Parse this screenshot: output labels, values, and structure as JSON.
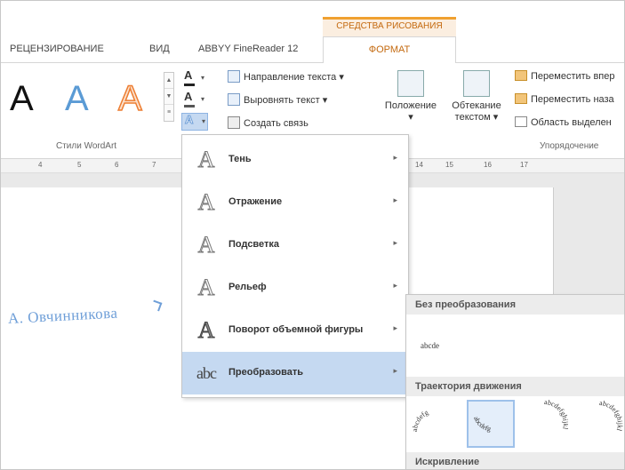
{
  "ribbon": {
    "context_group": "СРЕДСТВА РИСОВАНИЯ",
    "tabs": [
      "РЕЦЕНЗИРОВАНИЕ",
      "ВИД",
      "ABBYY FineReader 12",
      "ФОРМАТ"
    ],
    "wordart_styles_label": "Стили WordArt",
    "wordart_samples": [
      "A",
      "A",
      "A"
    ],
    "text_commands": [
      "Направление текста",
      "Выровнять текст",
      "Создать связь"
    ],
    "big_buttons": [
      {
        "label": "Положение"
      },
      {
        "label": "Обтекание текстом"
      }
    ],
    "arrange_commands": [
      "Переместить впер",
      "Переместить наза",
      "Область выделен"
    ],
    "arrange_label": "Упорядочение",
    "colors": {
      "accent": "#c46a10",
      "selected": "#c5d9f1",
      "wordart_blue": "#5b9bd5",
      "wordart_orange": "#ed7d31"
    }
  },
  "ruler": {
    "ticks": [
      "4",
      "5",
      "6",
      "7",
      "14",
      "15",
      "16",
      "17"
    ]
  },
  "document": {
    "wordart_text": "А. Овчинникова"
  },
  "menu": {
    "items": [
      {
        "icon": "A",
        "label": "Тень"
      },
      {
        "icon": "A",
        "label": "Отражение"
      },
      {
        "icon": "A",
        "label": "Подсветка"
      },
      {
        "icon": "A",
        "label": "Рельеф"
      },
      {
        "icon": "A",
        "label": "Поворот объемной фигуры"
      },
      {
        "icon": "abc",
        "label": "Преобразовать"
      }
    ]
  },
  "submenu": {
    "no_transform_header": "Без преобразования",
    "no_transform_sample": "abcde",
    "path_header": "Траектория движения",
    "warp_header": "Искривление",
    "path_items": [
      {
        "name": "arch-up",
        "text": "abcdefg"
      },
      {
        "name": "arch-down",
        "text": "abcdefg"
      },
      {
        "name": "circle",
        "text": "abcdefghijkl"
      },
      {
        "name": "button",
        "text": "abcdefghijkl"
      }
    ]
  }
}
